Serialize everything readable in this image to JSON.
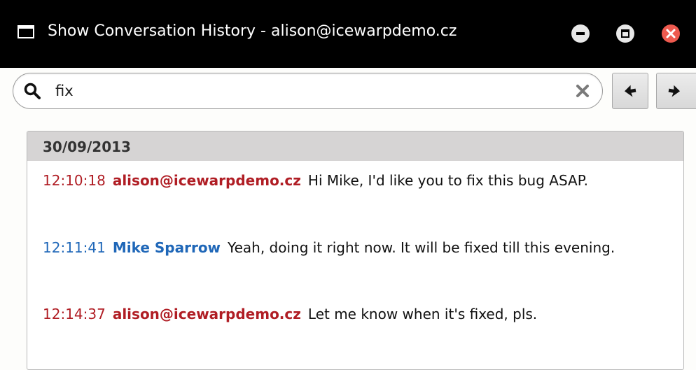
{
  "window": {
    "title": "Show Conversation History - alison@icewarpdemo.cz"
  },
  "search": {
    "value": "fix"
  },
  "history": {
    "date": "30/09/2013",
    "messages": [
      {
        "time": "12:10:18",
        "sender": "alison@icewarpdemo.cz",
        "text": "Hi Mike, I'd like you to fix this bug ASAP."
      },
      {
        "time": "12:11:41",
        "sender": "Mike Sparrow",
        "text": "Yeah, doing it right now. It will be fixed till this evening."
      },
      {
        "time": "12:14:37",
        "sender": "alison@icewarpdemo.cz",
        "text": "Let me know when it's fixed, pls."
      }
    ]
  },
  "colors": {
    "self": "#b01d24",
    "contact": "#1f67b8",
    "titlebar": "#000000",
    "close": "#ee5a4f"
  },
  "icons": {
    "window": "window-icon",
    "minimize": "minimize-icon",
    "maximize": "maximize-icon",
    "close": "close-icon",
    "search": "search-icon",
    "clear": "clear-icon",
    "prev": "arrow-left-icon",
    "next": "arrow-right-icon"
  }
}
